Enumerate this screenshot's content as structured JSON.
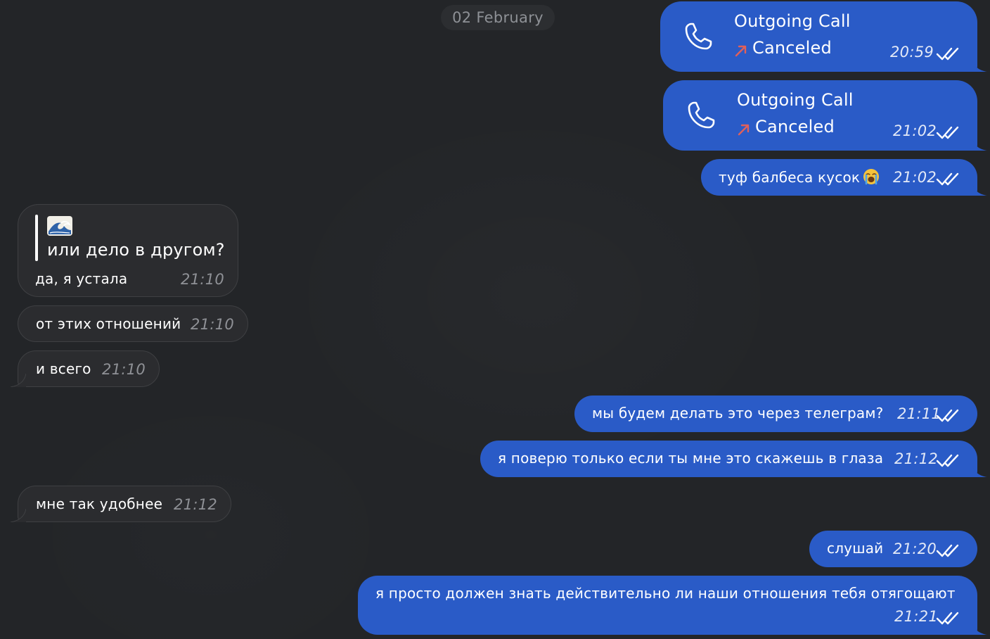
{
  "date_separator": "02 February",
  "messages": [
    {
      "type": "call",
      "direction": "out",
      "title": "Outgoing Call",
      "status": "Canceled",
      "time": "20:59",
      "read": true
    },
    {
      "type": "call",
      "direction": "out",
      "title": "Outgoing Call",
      "status": "Canceled",
      "time": "21:02",
      "read": true
    },
    {
      "type": "text",
      "direction": "out",
      "text": "туф балбеса кусок",
      "emoji": "loudly-crying-face",
      "time": "21:02",
      "read": true
    },
    {
      "type": "reply",
      "direction": "in",
      "quote_emoji": "water-wave",
      "quote_text": "или дело в другом?",
      "text": "да, я устала",
      "time": "21:10"
    },
    {
      "type": "text",
      "direction": "in",
      "text": "от этих отношений",
      "time": "21:10"
    },
    {
      "type": "text",
      "direction": "in",
      "text": "и всего",
      "time": "21:10"
    },
    {
      "type": "text",
      "direction": "out",
      "text": "мы будем делать это через телеграм?",
      "time": "21:11",
      "read": true
    },
    {
      "type": "text",
      "direction": "out",
      "text": "я поверю только если ты мне это скажешь в глаза",
      "time": "21:12",
      "read": true
    },
    {
      "type": "text",
      "direction": "in",
      "text": "мне так удобнее",
      "time": "21:12"
    },
    {
      "type": "text",
      "direction": "out",
      "text": "слушай",
      "time": "21:20",
      "read": true
    },
    {
      "type": "text",
      "direction": "out",
      "text": "я просто должен знать действительно ли наши отношения тебя отягощают",
      "time": "21:21",
      "read": true
    }
  ],
  "colors": {
    "background": "#232528",
    "outgoing_bubble": "#2a5bc7",
    "incoming_bubble": "#2b2c2f",
    "canceled_arrow": "#e0605a",
    "date_pill": "#2c2e31"
  },
  "icons": {
    "call": "phone-icon",
    "status_arrow": "outgoing-arrow-icon",
    "read": "double-check-icon"
  }
}
